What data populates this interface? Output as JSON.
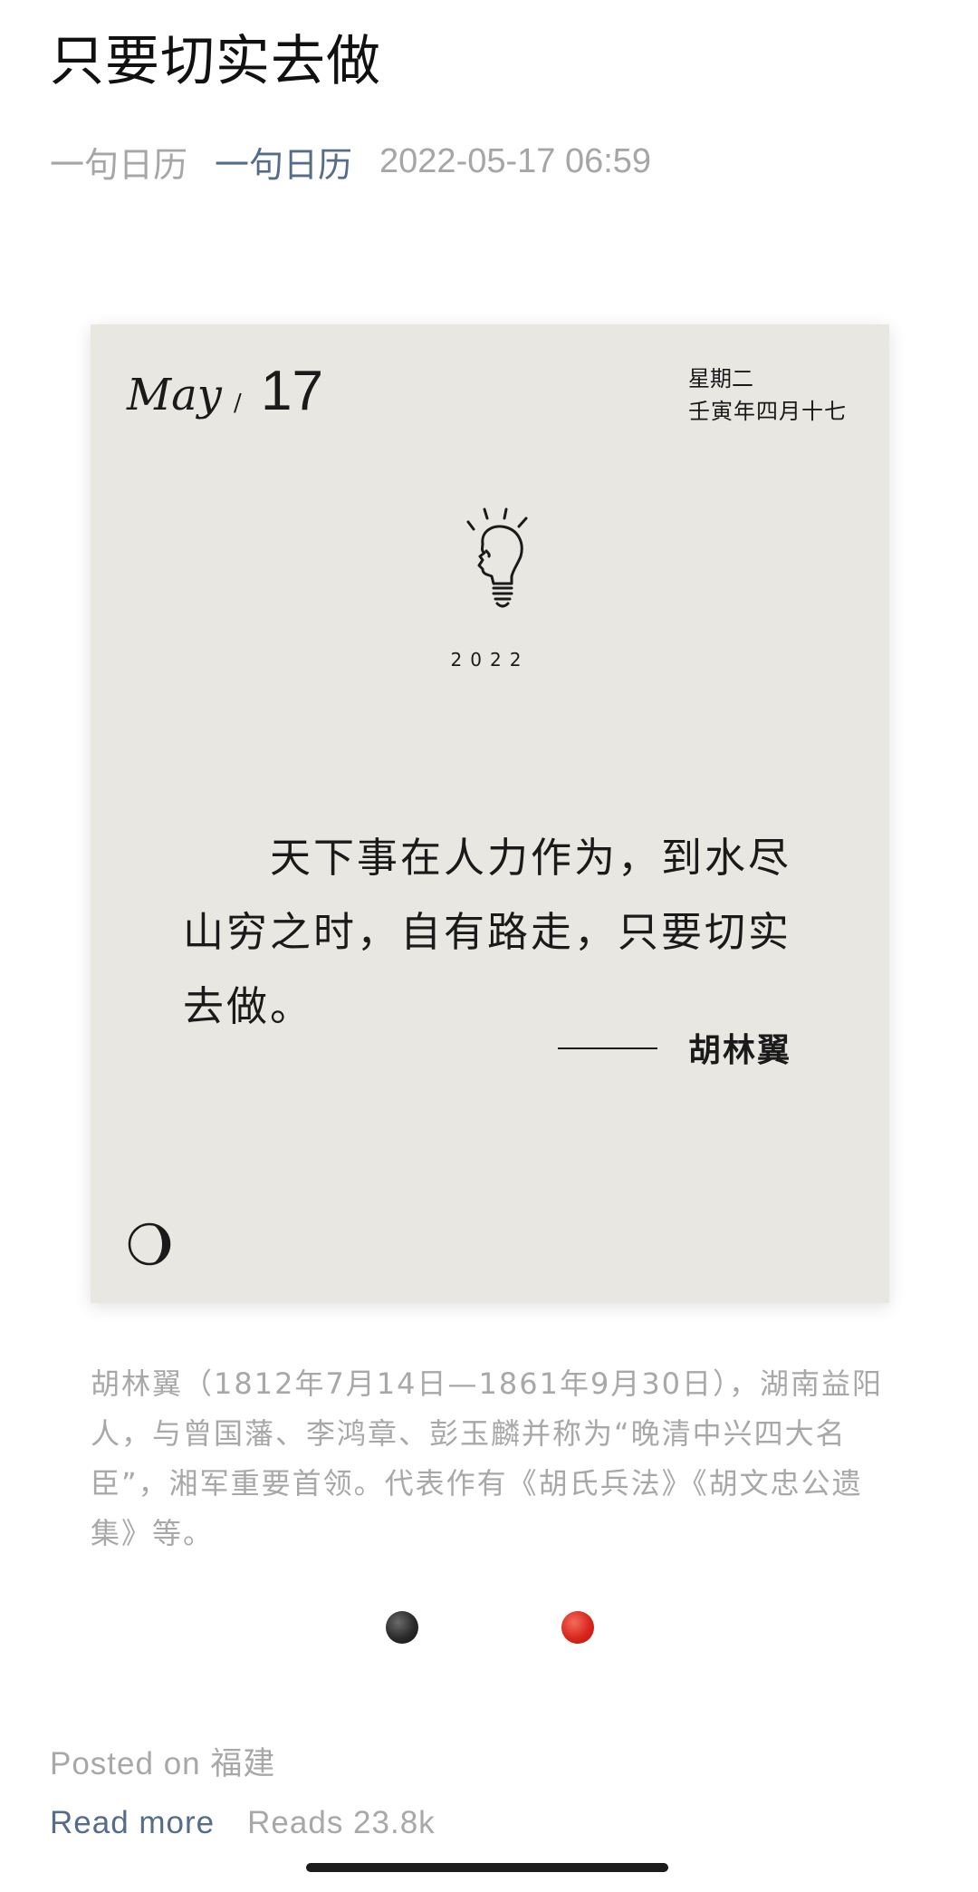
{
  "article": {
    "title": "只要切实去做",
    "author": "一句日历",
    "account": "一句日历",
    "datetime": "2022-05-17 06:59"
  },
  "card": {
    "month": "May",
    "slash": "/",
    "day": "17",
    "weekday": "星期二",
    "lunar_date": "壬寅年四月十七",
    "icon": "lightbulb-head-icon",
    "year": "2022",
    "quote": "天下事在人力作为，到水尽山穷之时，自有路走，只要切实去做。",
    "quote_author": "胡林翼",
    "moon_icon": "crescent-moon-icon",
    "background_color": "#e8e7e2"
  },
  "bio": "胡林翼（1812年7月14日—1861年9月30日），湖南益阳人，与曾国藩、李鸿章、彭玉麟并称为“晚清中兴四大名臣”，湘军重要首领。代表作有《胡氏兵法》《胡文忠公遗集》等。",
  "pager": {
    "dots": [
      {
        "color": "#2a2a2a"
      },
      {
        "color": "#d9261c"
      }
    ]
  },
  "footer": {
    "posted_prefix": "Posted on ",
    "location": "福建",
    "read_more_label": "Read more",
    "reads_label": "Reads 23.8k"
  },
  "colors": {
    "link": "#556c8a",
    "muted": "#a8a8a8"
  }
}
